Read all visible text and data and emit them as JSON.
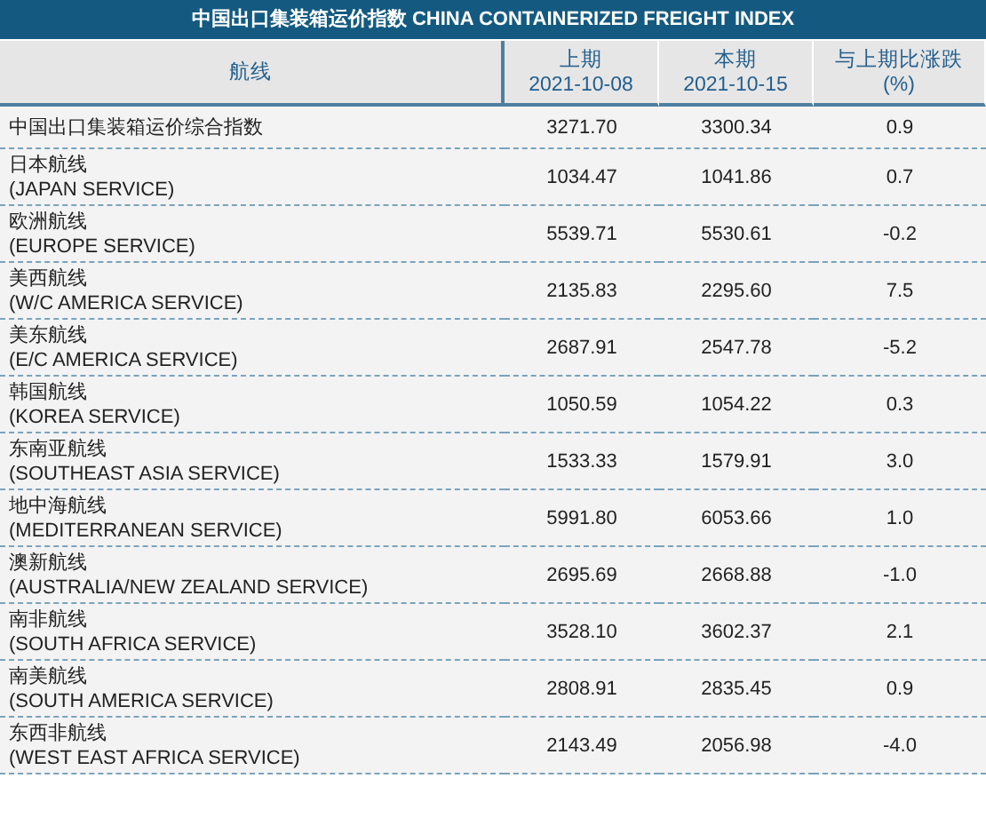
{
  "title": "中国出口集装箱运价指数 CHINA CONTAINERIZED FREIGHT INDEX",
  "columns": [
    {
      "label": "航线"
    },
    {
      "label": "上期",
      "sublabel": "2021-10-08"
    },
    {
      "label": "本期",
      "sublabel": "2021-10-15"
    },
    {
      "label": "与上期比涨跌",
      "sublabel": "(%)"
    }
  ],
  "rows": [
    {
      "route": "中国出口集装箱运价综合指数",
      "previous": "3271.70",
      "current": "3300.34",
      "change": "0.9"
    },
    {
      "route": "日本航线",
      "route_en": "(JAPAN SERVICE)",
      "previous": "1034.47",
      "current": "1041.86",
      "change": "0.7"
    },
    {
      "route": "欧洲航线",
      "route_en": "(EUROPE SERVICE)",
      "previous": "5539.71",
      "current": "5530.61",
      "change": "-0.2"
    },
    {
      "route": "美西航线",
      "route_en": "(W/C AMERICA SERVICE)",
      "previous": "2135.83",
      "current": "2295.60",
      "change": "7.5"
    },
    {
      "route": "美东航线",
      "route_en": "(E/C AMERICA SERVICE)",
      "previous": "2687.91",
      "current": "2547.78",
      "change": "-5.2"
    },
    {
      "route": "韩国航线",
      "route_en": "(KOREA SERVICE)",
      "previous": "1050.59",
      "current": "1054.22",
      "change": "0.3"
    },
    {
      "route": "东南亚航线",
      "route_en": "(SOUTHEAST ASIA SERVICE)",
      "previous": "1533.33",
      "current": "1579.91",
      "change": "3.0"
    },
    {
      "route": "地中海航线",
      "route_en": "(MEDITERRANEAN SERVICE)",
      "previous": "5991.80",
      "current": "6053.66",
      "change": "1.0"
    },
    {
      "route": "澳新航线",
      "route_en": "(AUSTRALIA/NEW ZEALAND SERVICE)",
      "previous": "2695.69",
      "current": "2668.88",
      "change": "-1.0"
    },
    {
      "route": "南非航线",
      "route_en": "(SOUTH AFRICA SERVICE)",
      "previous": "3528.10",
      "current": "3602.37",
      "change": "2.1"
    },
    {
      "route": "南美航线",
      "route_en": "(SOUTH AMERICA SERVICE)",
      "previous": "2808.91",
      "current": "2835.45",
      "change": "0.9"
    },
    {
      "route": "东西非航线",
      "route_en": "(WEST EAST AFRICA SERVICE)",
      "previous": "2143.49",
      "current": "2056.98",
      "change": "-4.0"
    }
  ]
}
